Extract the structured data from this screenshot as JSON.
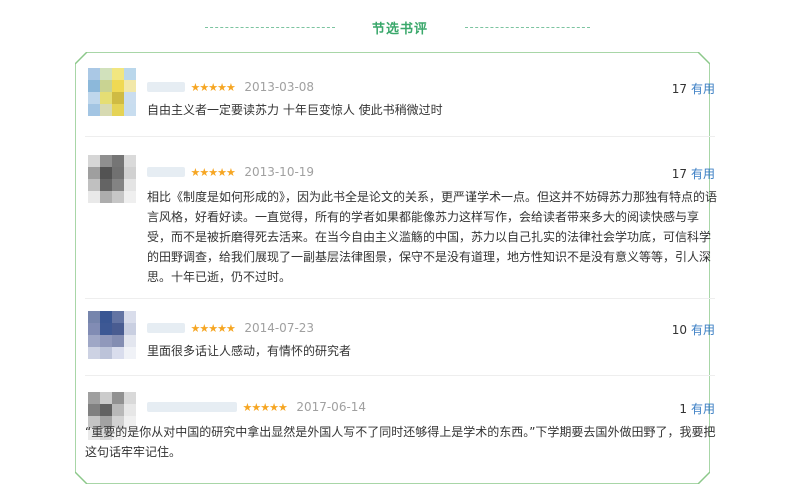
{
  "section_title": "节选书评",
  "reviews": [
    {
      "user": "",
      "stars": "★★★★★",
      "date": "2013-03-08",
      "useful_count": "17",
      "useful_label": "有用",
      "text": "自由主义者一定要读苏力 十年巨变惊人 使此书稍微过时",
      "avatar_colors": [
        "#a6c6e4",
        "#cfe0b9",
        "#f1e57a",
        "#b7d5ea",
        "#86b5d9",
        "#c7d18d",
        "#f0d84a",
        "#f2e7a5",
        "#bcd5ec",
        "#e4dd6d",
        "#cdb83a",
        "#c8dcef",
        "#9fc2e2",
        "#d5d9ae",
        "#e4d14e",
        "#c6dcef"
      ]
    },
    {
      "user": "",
      "stars": "★★★★★",
      "date": "2013-10-19",
      "useful_count": "17",
      "useful_label": "有用",
      "text": "相比《制度是如何形成的》，因为此书全是论文的关系，更严谨学术一点。但这并不妨碍苏力那独有特点的语言风格，好看好读。一直觉得，所有的学者如果都能像苏力这样写作，会给读者带来多大的阅读快感与享受，而不是被折磨得死去活来。在当今自由主义滥觞的中国，苏力以自己扎实的法律社会学功底，可信科学的田野调查，给我们展现了一副基层法律图景，保守不是没有道理，地方性知识不是没有意义等等，引人深思。十年已逝，仍不过时。",
      "avatar_colors": [
        "#d4d4d4",
        "#8a8a8a",
        "#6e6e6e",
        "#d9d9d9",
        "#9a9a9a",
        "#4a4a4a",
        "#6a6a6a",
        "#cfcfcf",
        "#bdbdbd",
        "#5c5c5c",
        "#7d7d7d",
        "#e3e3e3",
        "#e8e8e8",
        "#a9a9a9",
        "#c4c4c4",
        "#efefef"
      ]
    },
    {
      "user": "",
      "stars": "★★★★★",
      "date": "2014-07-23",
      "useful_count": "10",
      "useful_label": "有用",
      "text": "里面很多话让人感动，有情怀的研究者",
      "avatar_colors": [
        "#6f7fa8",
        "#2f4e8e",
        "#5b6d9f",
        "#d7dcea",
        "#7b86b0",
        "#33508f",
        "#40548c",
        "#c7cde0",
        "#9aa3c4",
        "#8b93b8",
        "#7d87ae",
        "#e2e5ef",
        "#cbd0e2",
        "#b9c0d8",
        "#d8dced",
        "#f0f2f7"
      ]
    },
    {
      "user": "",
      "stars": "★★★★★",
      "date": "2017-06-14",
      "useful_count": "1",
      "useful_label": "有用",
      "text": "“重要的是你从对中国的研究中拿出显然是外国人写不了同时还够得上是学术的东西。”下学期要去国外做田野了，我要把这句话牢牢记住。",
      "avatar_colors": [
        "#9a9a9a",
        "#c9c9c9",
        "#8c8c8c",
        "#d8d8d8",
        "#7a7a7a",
        "#5a5a5a",
        "#b5b5b5",
        "#e6e6e6",
        "#c2c2c2",
        "#9e9e9e",
        "#d0d0d0",
        "#f0f0f0",
        "#e9e9e9",
        "#d6d6d6",
        "#f2f2f2",
        "#fafafa"
      ]
    }
  ]
}
